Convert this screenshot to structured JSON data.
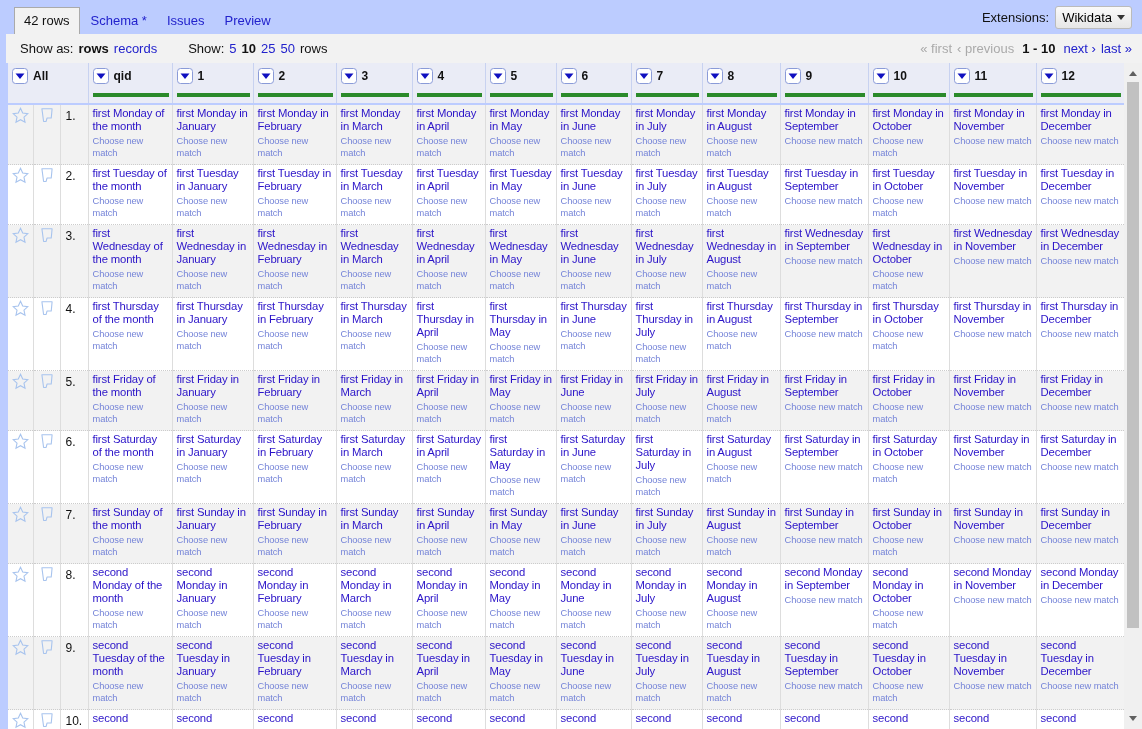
{
  "tabs": [
    {
      "label": "42 rows",
      "selected": true
    },
    {
      "label": "Schema *",
      "selected": false
    },
    {
      "label": "Issues",
      "selected": false
    },
    {
      "label": "Preview",
      "selected": false
    }
  ],
  "extensions": {
    "label": "Extensions:",
    "menu": "Wikidata"
  },
  "view_bar": {
    "show_as_label": "Show as:",
    "modes": [
      {
        "label": "rows",
        "selected": true
      },
      {
        "label": "records",
        "selected": false
      }
    ],
    "show_label": "Show:",
    "page_sizes": [
      {
        "label": "5",
        "selected": false
      },
      {
        "label": "10",
        "selected": true
      },
      {
        "label": "25",
        "selected": false
      },
      {
        "label": "50",
        "selected": false
      }
    ],
    "page_size_unit": "rows"
  },
  "pagination": {
    "first": {
      "label": "« first",
      "disabled": true
    },
    "previous": {
      "label": "‹ previous",
      "disabled": true
    },
    "range": "1 - 10",
    "next": {
      "label": "next ›",
      "disabled": false
    },
    "last": {
      "label": "last »",
      "disabled": false
    }
  },
  "table": {
    "all_label": "All",
    "columns": [
      {
        "name": "qid",
        "level": 1
      },
      {
        "name": "1",
        "level": 1
      },
      {
        "name": "2",
        "level": 1
      },
      {
        "name": "3",
        "level": 1
      },
      {
        "name": "4",
        "level": 1
      },
      {
        "name": "5",
        "level": 1
      },
      {
        "name": "6",
        "level": 1
      },
      {
        "name": "7",
        "level": 1
      },
      {
        "name": "8",
        "level": 1
      },
      {
        "name": "9",
        "level": 1
      },
      {
        "name": "10",
        "level": 1
      },
      {
        "name": "11",
        "level": 1
      },
      {
        "name": "12",
        "level": 1
      }
    ],
    "rows": [
      {
        "number": "1.",
        "starred": false,
        "flagged": false,
        "cells": [
          {
            "value": "first Monday of the month",
            "action": "Choose new match"
          },
          {
            "value": "first Monday in January",
            "action": "Choose new match"
          },
          {
            "value": "first Monday in February",
            "action": "Choose new match"
          },
          {
            "value": "first Monday in March",
            "action": "Choose new match"
          },
          {
            "value": "first Monday in April",
            "action": "Choose new match"
          },
          {
            "value": "first Monday in May",
            "action": "Choose new match"
          },
          {
            "value": "first Monday in June",
            "action": "Choose new match"
          },
          {
            "value": "first Monday in July",
            "action": "Choose new match"
          },
          {
            "value": "first Monday in August",
            "action": "Choose new match"
          },
          {
            "value": "first Monday in September",
            "action": "Choose new match"
          },
          {
            "value": "first Monday in October",
            "action": "Choose new match"
          },
          {
            "value": "first Monday in November",
            "action": "Choose new match"
          },
          {
            "value": "first Monday in December",
            "action": "Choose new match"
          }
        ]
      },
      {
        "number": "2.",
        "starred": false,
        "flagged": false,
        "cells": [
          {
            "value": "first Tuesday of the month",
            "action": "Choose new match"
          },
          {
            "value": "first Tuesday in January",
            "action": "Choose new match"
          },
          {
            "value": "first Tuesday in February",
            "action": "Choose new match"
          },
          {
            "value": "first Tuesday in March",
            "action": "Choose new match"
          },
          {
            "value": "first Tuesday in April",
            "action": "Choose new match"
          },
          {
            "value": "first Tuesday in May",
            "action": "Choose new match"
          },
          {
            "value": "first Tuesday in June",
            "action": "Choose new match"
          },
          {
            "value": "first Tuesday in July",
            "action": "Choose new match"
          },
          {
            "value": "first Tuesday in August",
            "action": "Choose new match"
          },
          {
            "value": "first Tuesday in September",
            "action": "Choose new match"
          },
          {
            "value": "first Tuesday in October",
            "action": "Choose new match"
          },
          {
            "value": "first Tuesday in November",
            "action": "Choose new match"
          },
          {
            "value": "first Tuesday in December",
            "action": "Choose new match"
          }
        ]
      },
      {
        "number": "3.",
        "starred": false,
        "flagged": false,
        "cells": [
          {
            "value": "first Wednesday of the month",
            "action": "Choose new match"
          },
          {
            "value": "first Wednesday in January",
            "action": "Choose new match"
          },
          {
            "value": "first Wednesday in February",
            "action": "Choose new match"
          },
          {
            "value": "first Wednesday in March",
            "action": "Choose new match"
          },
          {
            "value": "first Wednesday in April",
            "action": "Choose new match"
          },
          {
            "value": "first Wednesday in May",
            "action": "Choose new match"
          },
          {
            "value": "first Wednesday in June",
            "action": "Choose new match"
          },
          {
            "value": "first Wednesday in July",
            "action": "Choose new match"
          },
          {
            "value": "first Wednesday in August",
            "action": "Choose new match"
          },
          {
            "value": "first Wednesday in September",
            "action": "Choose new match"
          },
          {
            "value": "first Wednesday in October",
            "action": "Choose new match"
          },
          {
            "value": "first Wednesday in November",
            "action": "Choose new match"
          },
          {
            "value": "first Wednesday in December",
            "action": "Choose new match"
          }
        ]
      },
      {
        "number": "4.",
        "starred": false,
        "flagged": false,
        "cells": [
          {
            "value": "first Thursday of the month",
            "action": "Choose new match"
          },
          {
            "value": "first Thursday in January",
            "action": "Choose new match"
          },
          {
            "value": "first Thursday in February",
            "action": "Choose new match"
          },
          {
            "value": "first Thursday in March",
            "action": "Choose new match"
          },
          {
            "value": "first Thursday in April",
            "action": "Choose new match"
          },
          {
            "value": "first Thursday in May",
            "action": "Choose new match"
          },
          {
            "value": "first Thursday in June",
            "action": "Choose new match"
          },
          {
            "value": "first Thursday in July",
            "action": "Choose new match"
          },
          {
            "value": "first Thursday in August",
            "action": "Choose new match"
          },
          {
            "value": "first Thursday in September",
            "action": "Choose new match"
          },
          {
            "value": "first Thursday in October",
            "action": "Choose new match"
          },
          {
            "value": "first Thursday in November",
            "action": "Choose new match"
          },
          {
            "value": "first Thursday in December",
            "action": "Choose new match"
          }
        ]
      },
      {
        "number": "5.",
        "starred": false,
        "flagged": false,
        "cells": [
          {
            "value": "first Friday of the month",
            "action": "Choose new match"
          },
          {
            "value": "first Friday in January",
            "action": "Choose new match"
          },
          {
            "value": "first Friday in February",
            "action": "Choose new match"
          },
          {
            "value": "first Friday in March",
            "action": "Choose new match"
          },
          {
            "value": "first Friday in April",
            "action": "Choose new match"
          },
          {
            "value": "first Friday in May",
            "action": "Choose new match"
          },
          {
            "value": "first Friday in June",
            "action": "Choose new match"
          },
          {
            "value": "first Friday in July",
            "action": "Choose new match"
          },
          {
            "value": "first Friday in August",
            "action": "Choose new match"
          },
          {
            "value": "first Friday in September",
            "action": "Choose new match"
          },
          {
            "value": "first Friday in October",
            "action": "Choose new match"
          },
          {
            "value": "first Friday in November",
            "action": "Choose new match"
          },
          {
            "value": "first Friday in December",
            "action": "Choose new match"
          }
        ]
      },
      {
        "number": "6.",
        "starred": false,
        "flagged": false,
        "cells": [
          {
            "value": "first Saturday of the month",
            "action": "Choose new match"
          },
          {
            "value": "first Saturday in January",
            "action": "Choose new match"
          },
          {
            "value": "first Saturday in February",
            "action": "Choose new match"
          },
          {
            "value": "first Saturday in March",
            "action": "Choose new match"
          },
          {
            "value": "first Saturday in April",
            "action": "Choose new match"
          },
          {
            "value": "first Saturday in May",
            "action": "Choose new match"
          },
          {
            "value": "first Saturday in June",
            "action": "Choose new match"
          },
          {
            "value": "first Saturday in July",
            "action": "Choose new match"
          },
          {
            "value": "first Saturday in August",
            "action": "Choose new match"
          },
          {
            "value": "first Saturday in September",
            "action": "Choose new match"
          },
          {
            "value": "first Saturday in October",
            "action": "Choose new match"
          },
          {
            "value": "first Saturday in November",
            "action": "Choose new match"
          },
          {
            "value": "first Saturday in December",
            "action": "Choose new match"
          }
        ]
      },
      {
        "number": "7.",
        "starred": false,
        "flagged": false,
        "cells": [
          {
            "value": "first Sunday of the month",
            "action": "Choose new match"
          },
          {
            "value": "first Sunday in January",
            "action": "Choose new match"
          },
          {
            "value": "first Sunday in February",
            "action": "Choose new match"
          },
          {
            "value": "first Sunday in March",
            "action": "Choose new match"
          },
          {
            "value": "first Sunday in April",
            "action": "Choose new match"
          },
          {
            "value": "first Sunday in May",
            "action": "Choose new match"
          },
          {
            "value": "first Sunday in June",
            "action": "Choose new match"
          },
          {
            "value": "first Sunday in July",
            "action": "Choose new match"
          },
          {
            "value": "first Sunday in August",
            "action": "Choose new match"
          },
          {
            "value": "first Sunday in September",
            "action": "Choose new match"
          },
          {
            "value": "first Sunday in October",
            "action": "Choose new match"
          },
          {
            "value": "first Sunday in November",
            "action": "Choose new match"
          },
          {
            "value": "first Sunday in December",
            "action": "Choose new match"
          }
        ]
      },
      {
        "number": "8.",
        "starred": false,
        "flagged": false,
        "cells": [
          {
            "value": "second Monday of the month",
            "action": "Choose new match"
          },
          {
            "value": "second Monday in January",
            "action": "Choose new match"
          },
          {
            "value": "second Monday in February",
            "action": "Choose new match"
          },
          {
            "value": "second Monday in March",
            "action": "Choose new match"
          },
          {
            "value": "second Monday in April",
            "action": "Choose new match"
          },
          {
            "value": "second Monday in May",
            "action": "Choose new match"
          },
          {
            "value": "second Monday in June",
            "action": "Choose new match"
          },
          {
            "value": "second Monday in July",
            "action": "Choose new match"
          },
          {
            "value": "second Monday in August",
            "action": "Choose new match"
          },
          {
            "value": "second Monday in September",
            "action": "Choose new match"
          },
          {
            "value": "second Monday in October",
            "action": "Choose new match"
          },
          {
            "value": "second Monday in November",
            "action": "Choose new match"
          },
          {
            "value": "second Monday in December",
            "action": "Choose new match"
          }
        ]
      },
      {
        "number": "9.",
        "starred": false,
        "flagged": false,
        "cells": [
          {
            "value": "second Tuesday of the month",
            "action": "Choose new match"
          },
          {
            "value": "second Tuesday in January",
            "action": "Choose new match"
          },
          {
            "value": "second Tuesday in February",
            "action": "Choose new match"
          },
          {
            "value": "second Tuesday in March",
            "action": "Choose new match"
          },
          {
            "value": "second Tuesday in April",
            "action": "Choose new match"
          },
          {
            "value": "second Tuesday in May",
            "action": "Choose new match"
          },
          {
            "value": "second Tuesday in June",
            "action": "Choose new match"
          },
          {
            "value": "second Tuesday in July",
            "action": "Choose new match"
          },
          {
            "value": "second Tuesday in August",
            "action": "Choose new match"
          },
          {
            "value": "second Tuesday in September",
            "action": "Choose new match"
          },
          {
            "value": "second Tuesday in October",
            "action": "Choose new match"
          },
          {
            "value": "second Tuesday in November",
            "action": "Choose new match"
          },
          {
            "value": "second Tuesday in December",
            "action": "Choose new match"
          }
        ]
      },
      {
        "number": "10.",
        "starred": false,
        "flagged": false,
        "cells": [
          {
            "value": "second"
          },
          {
            "value": "second"
          },
          {
            "value": "second"
          },
          {
            "value": "second"
          },
          {
            "value": "second"
          },
          {
            "value": "second"
          },
          {
            "value": "second"
          },
          {
            "value": "second"
          },
          {
            "value": "second"
          },
          {
            "value": "second"
          },
          {
            "value": "second"
          },
          {
            "value": "second"
          },
          {
            "value": "second"
          }
        ]
      }
    ]
  }
}
